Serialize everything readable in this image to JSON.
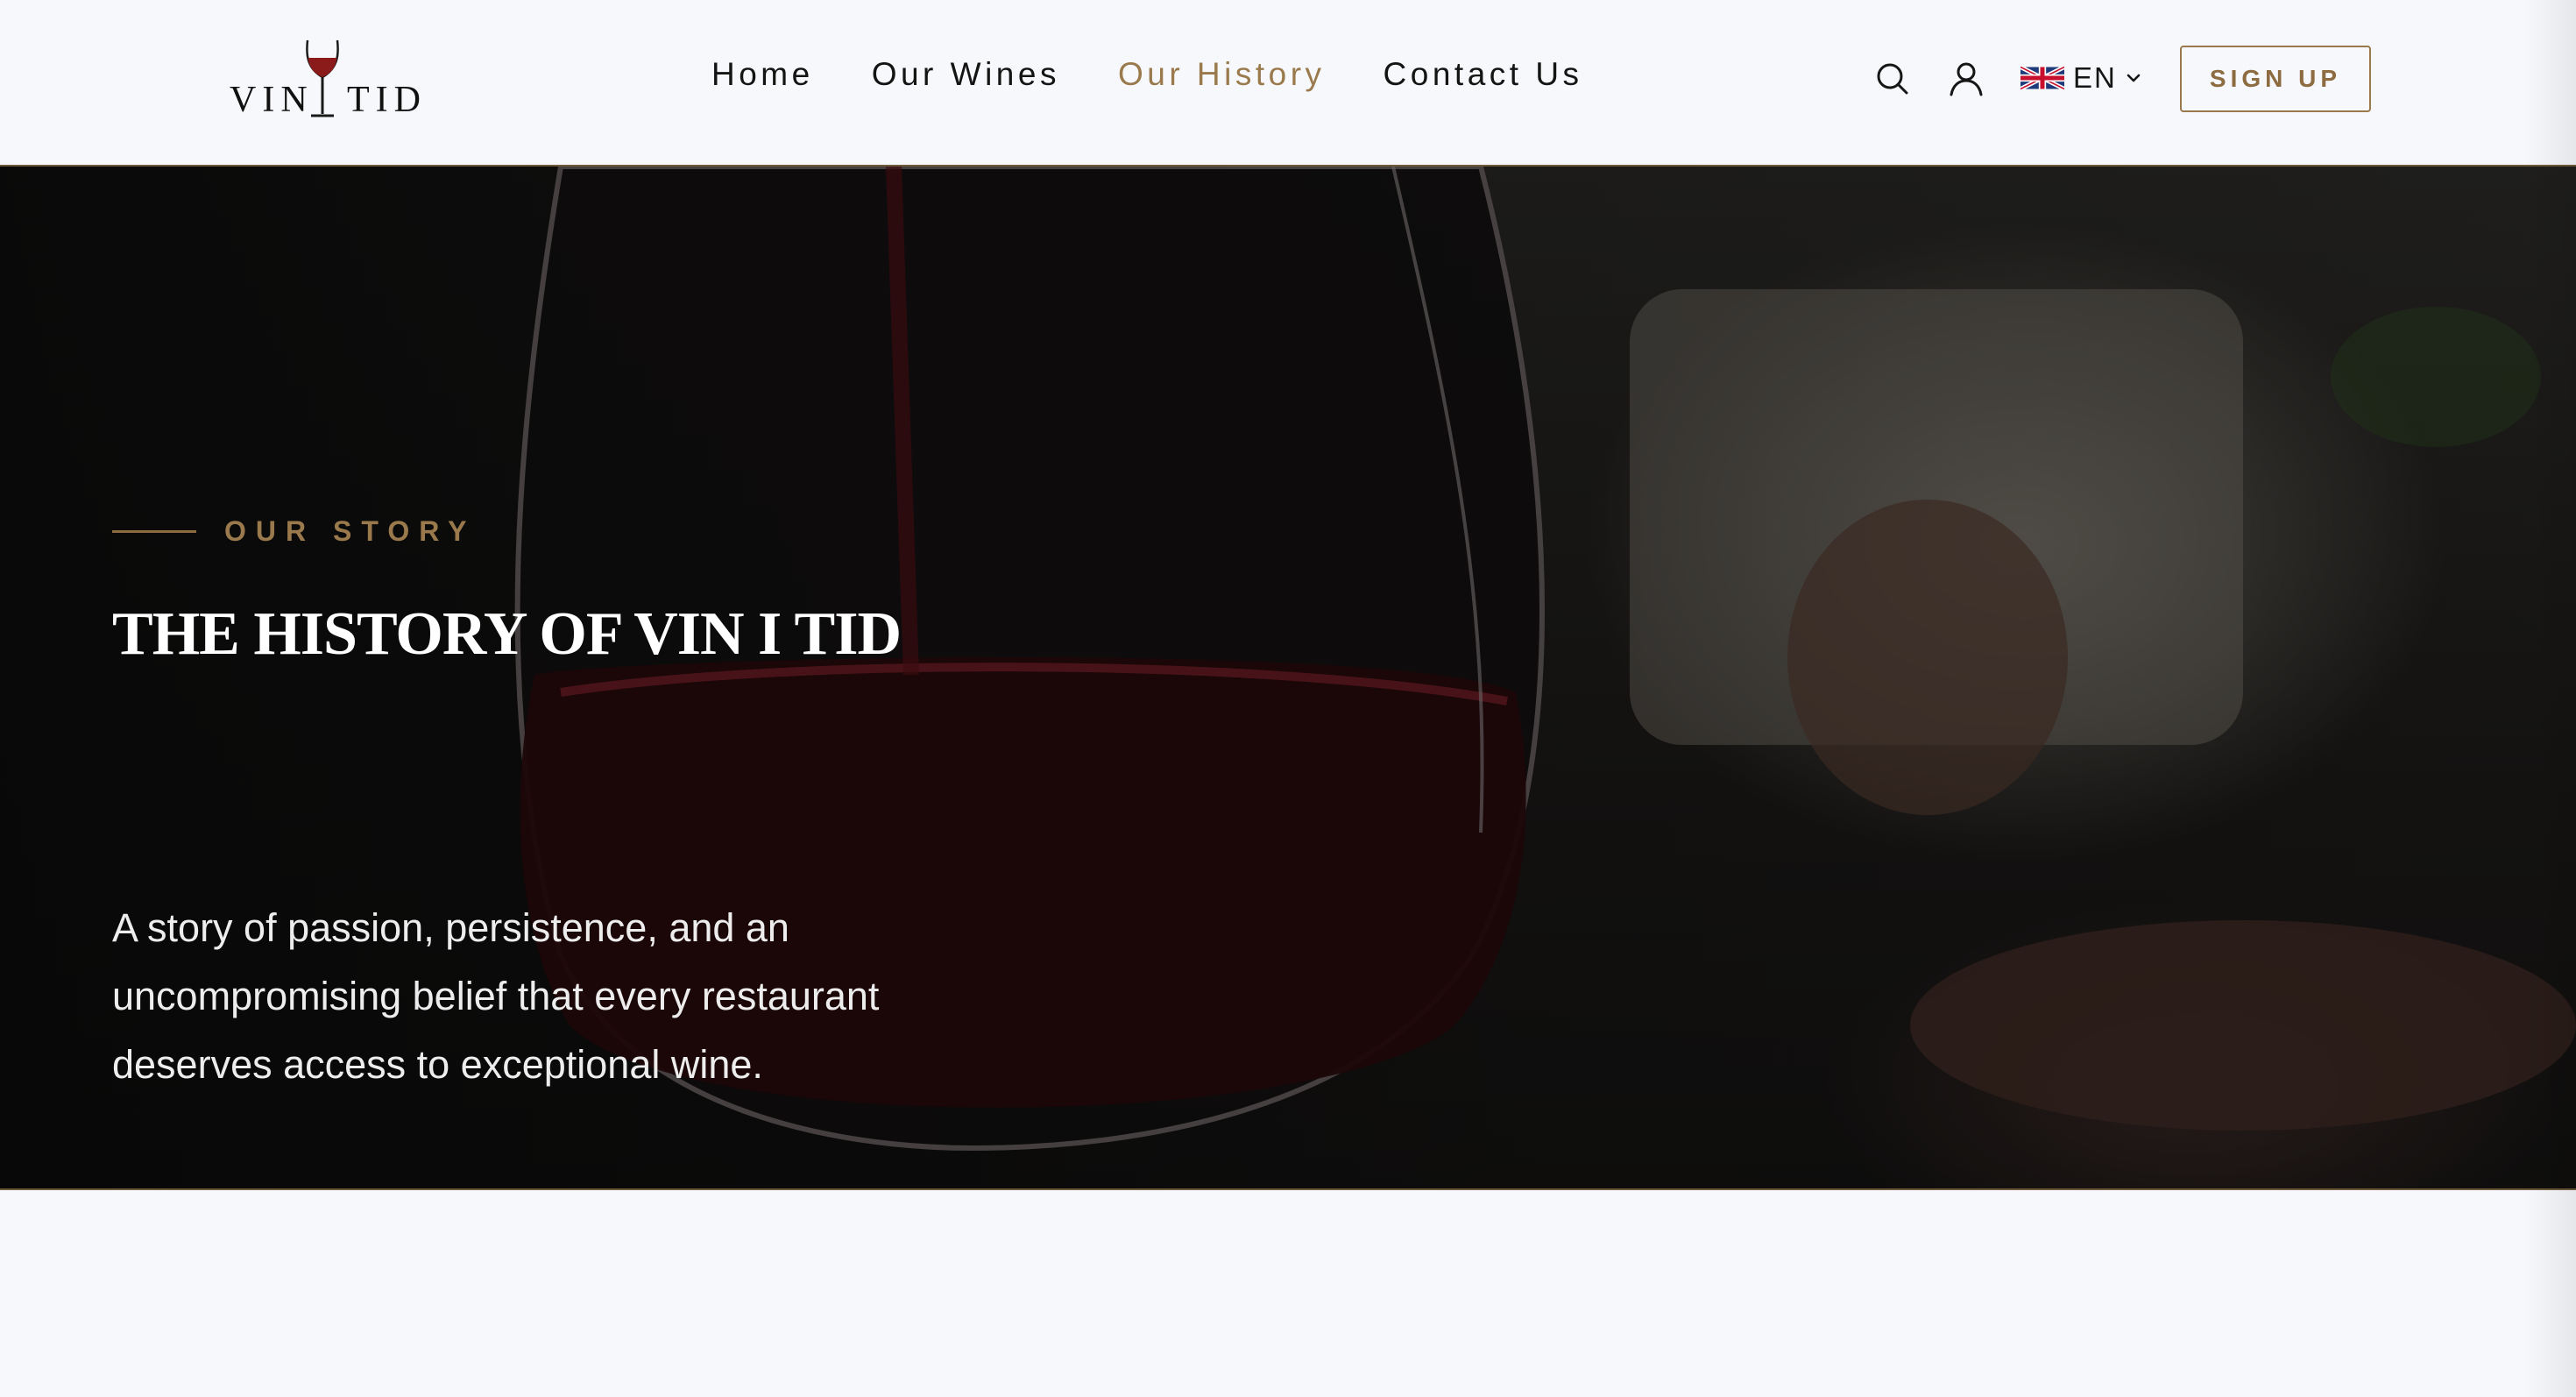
{
  "brand": {
    "logo_left": "VIN",
    "logo_right": "TID",
    "accent_color": "#9a7a4c",
    "wine_color": "#8b1a1a"
  },
  "nav": {
    "items": [
      {
        "label": "Home",
        "active": false
      },
      {
        "label": "Our Wines",
        "active": false
      },
      {
        "label": "Our History",
        "active": true
      },
      {
        "label": "Contact Us",
        "active": false
      }
    ]
  },
  "header_actions": {
    "search_icon": "search-icon",
    "account_icon": "user-icon",
    "language_flag": "uk-flag-icon",
    "language_code": "EN",
    "signup_label": "SIGN UP"
  },
  "hero": {
    "eyebrow": "OUR STORY",
    "title": "THE HISTORY OF VIN I TID",
    "text": "A story of passion, persistence, and an uncompromising belief that every restaurant deserves access to exceptional wine."
  }
}
